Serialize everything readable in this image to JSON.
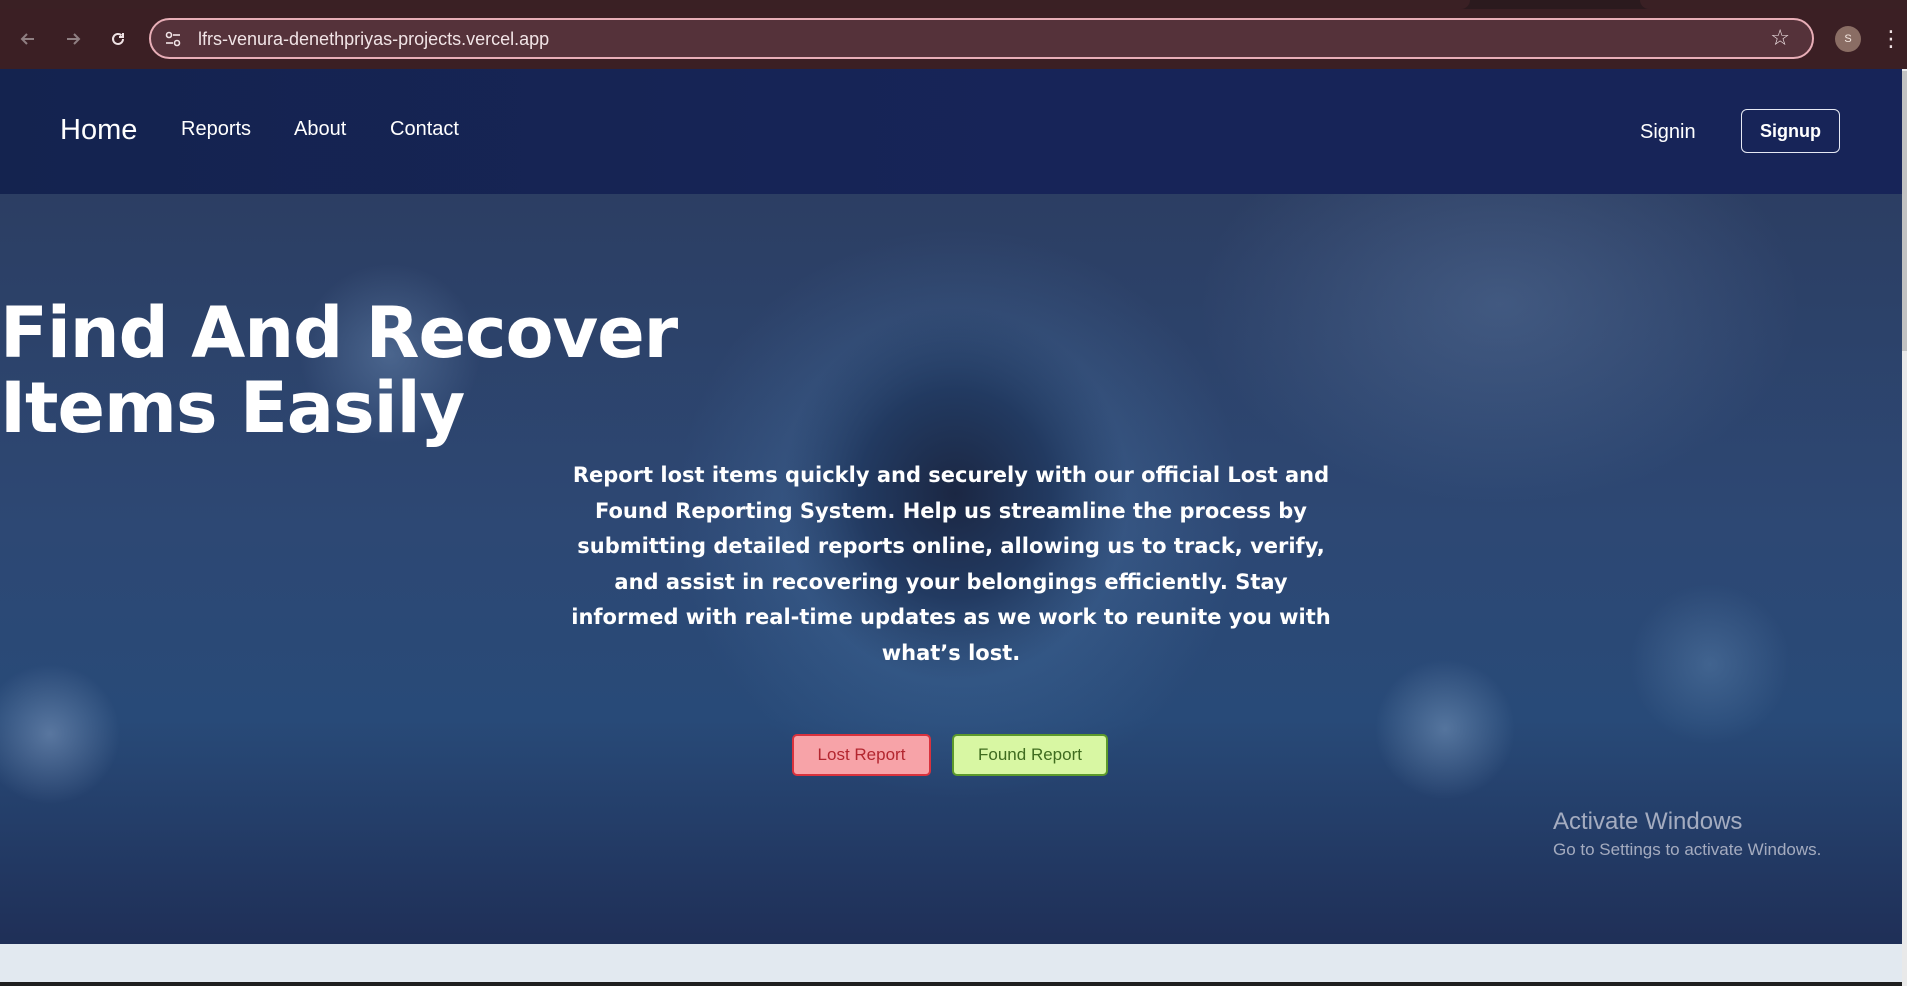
{
  "browser": {
    "url": "lfrs-venura-denethpriyas-projects.vercel.app",
    "profile_initial": "S",
    "icons": {
      "back": "arrow-left-icon",
      "forward": "arrow-right-icon",
      "reload": "reload-icon",
      "site_info": "tune-icon",
      "bookmark": "star-icon",
      "menu": "kebab-icon"
    }
  },
  "nav": {
    "brand": "Home",
    "links": [
      "Reports",
      "About",
      "Contact"
    ],
    "signin": "Signin",
    "signup": "Signup"
  },
  "hero": {
    "title_line1": "Find And Recover",
    "title_line2": "Items Easily",
    "description": "Report lost items quickly and securely with our official Lost and Found Reporting System. Help us streamline the process by submitting detailed reports online, allowing us to track, verify, and assist in recovering your belongings efficiently. Stay informed with real-time updates as we work to reunite you with what’s lost.",
    "lost_button": "Lost Report",
    "found_button": "Found Report"
  },
  "watermark": {
    "title": "Activate Windows",
    "subtitle": "Go to Settings to activate Windows."
  },
  "colors": {
    "nav_bg": "#172458",
    "lost_bg": "#f7a3a8",
    "lost_border": "#d9323d",
    "found_bg": "#d8f7a3",
    "found_border": "#5c9a2b"
  }
}
